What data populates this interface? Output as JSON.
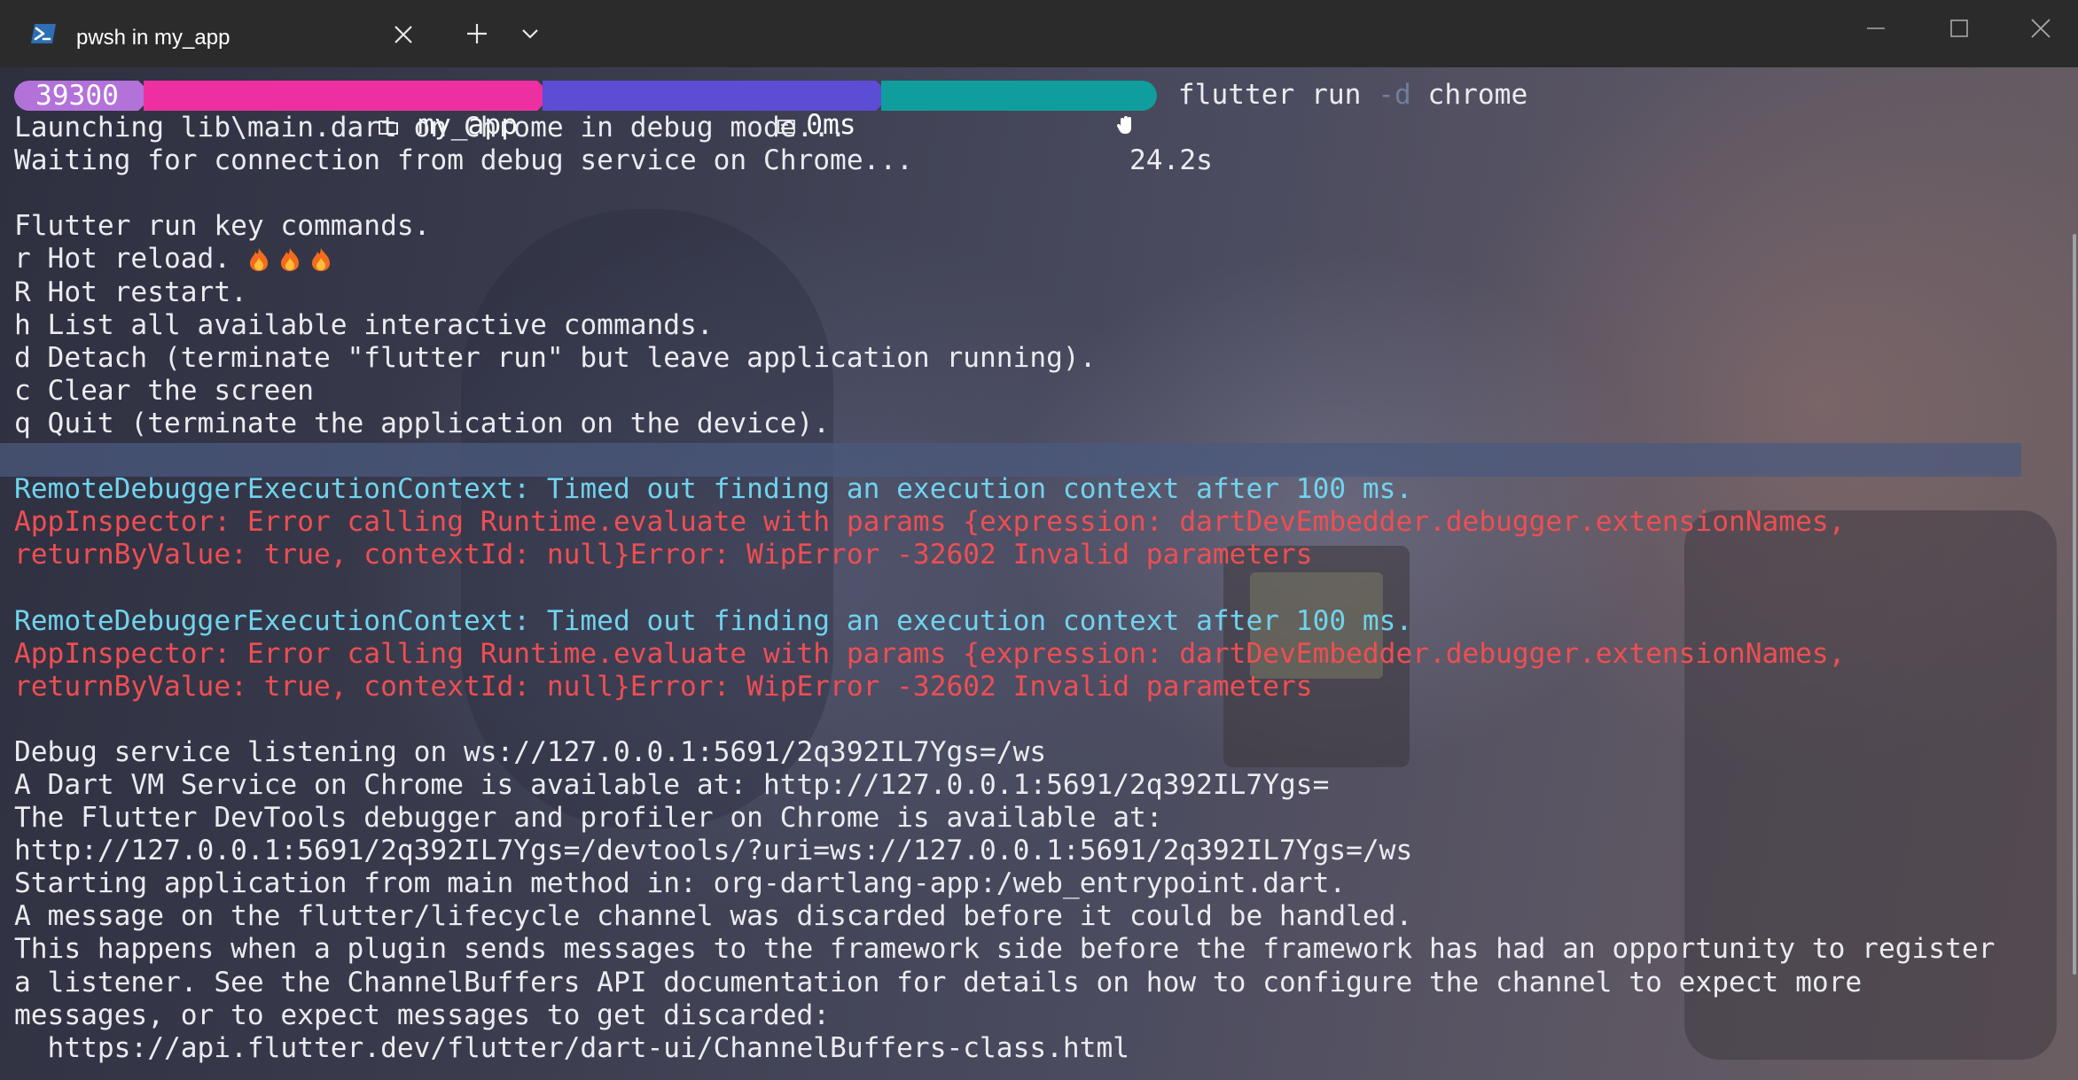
{
  "window": {
    "tab_title": "pwsh in my_app",
    "tab_icon": "powershell-icon"
  },
  "colors": {
    "prompt_seg1": "#b372d9",
    "prompt_seg2": "#ee2fa2",
    "prompt_seg3": "#5b4dd4",
    "prompt_seg4": "#109d9d",
    "cyan_text": "#70d3ee",
    "red_text": "#ef4e52"
  },
  "prompt": {
    "seg1": "39300",
    "seg2_icon": "folder-icon",
    "seg2": "my_app",
    "seg3_icon": "timer-icon",
    "seg3": "0ms",
    "seg4_icon": "hand-icon",
    "command_pre": "flutter run ",
    "command_flag": "-d",
    "command_post": " chrome"
  },
  "output": {
    "l1": "Launching lib\\main.dart on Chrome in debug mode...",
    "l2": "Waiting for connection from debug service on Chrome...             24.2s",
    "l3": "",
    "l4": "Flutter run key commands.",
    "l5": "r Hot reload. ",
    "l5_icons": [
      "fire-icon",
      "fire-icon",
      "fire-icon"
    ],
    "l6": "R Hot restart.",
    "l7": "h List all available interactive commands.",
    "l8": "d Detach (terminate \"flutter run\" but leave application running).",
    "l9": "c Clear the screen",
    "l10": "q Quit (terminate the application on the device).",
    "l11": "",
    "l12": "RemoteDebuggerExecutionContext: Timed out finding an execution context after 100 ms.",
    "l13": "AppInspector: Error calling Runtime.evaluate with params {expression: dartDevEmbedder.debugger.extensionNames,",
    "l14": "returnByValue: true, contextId: null}Error: WipError -32602 Invalid parameters",
    "l15": "",
    "l16": "RemoteDebuggerExecutionContext: Timed out finding an execution context after 100 ms.",
    "l17": "AppInspector: Error calling Runtime.evaluate with params {expression: dartDevEmbedder.debugger.extensionNames,",
    "l18": "returnByValue: true, contextId: null}Error: WipError -32602 Invalid parameters",
    "l19": "",
    "l20": "Debug service listening on ws://127.0.0.1:5691/2q392IL7Ygs=/ws",
    "l21": "A Dart VM Service on Chrome is available at: http://127.0.0.1:5691/2q392IL7Ygs=",
    "l22": "The Flutter DevTools debugger and profiler on Chrome is available at:",
    "l23": "http://127.0.0.1:5691/2q392IL7Ygs=/devtools/?uri=ws://127.0.0.1:5691/2q392IL7Ygs=/ws",
    "l24": "Starting application from main method in: org-dartlang-app:/web_entrypoint.dart.",
    "l25": "A message on the flutter/lifecycle channel was discarded before it could be handled.",
    "l26": "This happens when a plugin sends messages to the framework side before the framework has had an opportunity to register",
    "l27": "a listener. See the ChannelBuffers API documentation for details on how to configure the channel to expect more",
    "l28": "messages, or to expect messages to get discarded:",
    "l29": "  https://api.flutter.dev/flutter/dart-ui/ChannelBuffers-class.html"
  }
}
